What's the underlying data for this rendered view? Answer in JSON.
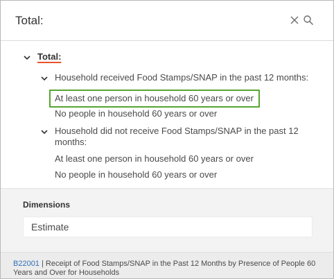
{
  "header": {
    "title": "Total:",
    "close_icon": "close-icon",
    "search_icon": "search-icon"
  },
  "tree": {
    "root": {
      "label": "Total:",
      "expanded": true
    },
    "groups": [
      {
        "label": "Household received Food Stamps/SNAP in the past 12 months:",
        "expanded": true,
        "items": [
          {
            "label": "At least one person in household 60 years or over",
            "selected": true
          },
          {
            "label": "No people in household 60 years or over",
            "selected": false
          }
        ]
      },
      {
        "label_line1": "Household did not receive Food Stamps/SNAP in the past 12",
        "label_line2": "months:",
        "expanded": true,
        "items": [
          {
            "label": "At least one person in household 60 years or over",
            "selected": false
          },
          {
            "label": "No people in household 60 years or over",
            "selected": false
          }
        ]
      }
    ]
  },
  "dimensions": {
    "title": "Dimensions",
    "value": "Estimate"
  },
  "footer": {
    "table_code": "B22001",
    "separator": "|",
    "line1": "Receipt of Food Stamps/SNAP in the Past 12 Months by Presence of People 60",
    "line2": "Years and Over for Households"
  },
  "colors": {
    "selected_border": "#55a630",
    "underline_accent": "#e8522a",
    "link": "#2f6fb4"
  }
}
